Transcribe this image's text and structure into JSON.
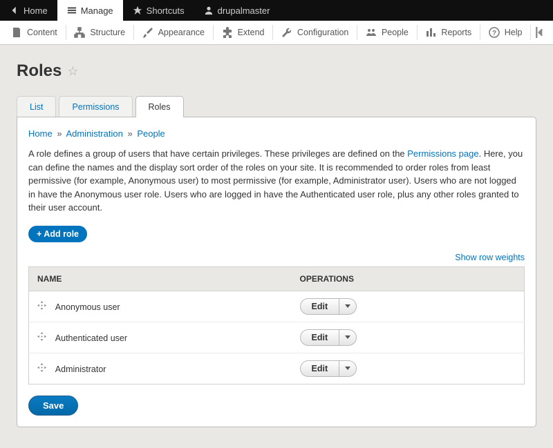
{
  "toolbar": {
    "home": "Home",
    "manage": "Manage",
    "shortcuts": "Shortcuts",
    "user": "drupalmaster"
  },
  "admin_menu": {
    "content": "Content",
    "structure": "Structure",
    "appearance": "Appearance",
    "extend": "Extend",
    "configuration": "Configuration",
    "people": "People",
    "reports": "Reports",
    "help": "Help"
  },
  "page_title": "Roles",
  "tabs": {
    "list": "List",
    "permissions": "Permissions",
    "roles": "Roles"
  },
  "breadcrumb": {
    "home": "Home",
    "admin": "Administration",
    "people": "People"
  },
  "description": {
    "t1": "A role defines a group of users that have certain privileges. These privileges are defined on the ",
    "link": "Permissions page",
    "t2": ". Here, you can define the names and the display sort order of the roles on your site. It is recommended to order roles from least permissive (for example, Anonymous user) to most permissive (for example, Administrator user). Users who are not logged in have the Anonymous user role. Users who are logged in have the Authenticated user role, plus any other roles granted to their user account."
  },
  "add_role_label": "+ Add role",
  "show_weights": "Show row weights",
  "table": {
    "headers": {
      "name": "NAME",
      "operations": "OPERATIONS"
    },
    "rows": [
      {
        "name": "Anonymous user",
        "op": "Edit"
      },
      {
        "name": "Authenticated user",
        "op": "Edit"
      },
      {
        "name": "Administrator",
        "op": "Edit"
      }
    ]
  },
  "save_label": "Save"
}
